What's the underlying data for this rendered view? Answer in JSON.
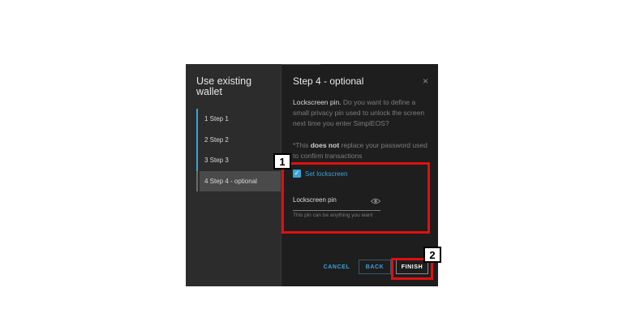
{
  "wizard": {
    "title": "Use existing wallet",
    "steps": [
      {
        "label": "1  Step 1"
      },
      {
        "label": "2  Step 2"
      },
      {
        "label": "3  Step 3"
      },
      {
        "label": "4  Step 4 - optional"
      }
    ]
  },
  "content": {
    "heading": "Step 4 - optional",
    "close_icon": "×",
    "desc_strong": "Lockscreen pin.",
    "desc_rest": " Do you want to define a small privacy pin used to unlock the screen next time you enter SimplEOS?",
    "note_prefix": "*This ",
    "note_bold": "does not",
    "note_suffix": " replace your password used to confirm transactions",
    "checkbox_label": "Set lockscreen",
    "checkbox_mark": "✓",
    "pin_label": "Lockscreen pin",
    "pin_hint": "This pin can be anything you want"
  },
  "footer": {
    "cancel_label": "CANCEL",
    "back_label": "BACK",
    "finish_label": "FINISH"
  },
  "annotations": {
    "badge1": "1",
    "badge2": "2"
  },
  "colors": {
    "accent": "#3aa3d9",
    "annotation": "#e01010"
  }
}
